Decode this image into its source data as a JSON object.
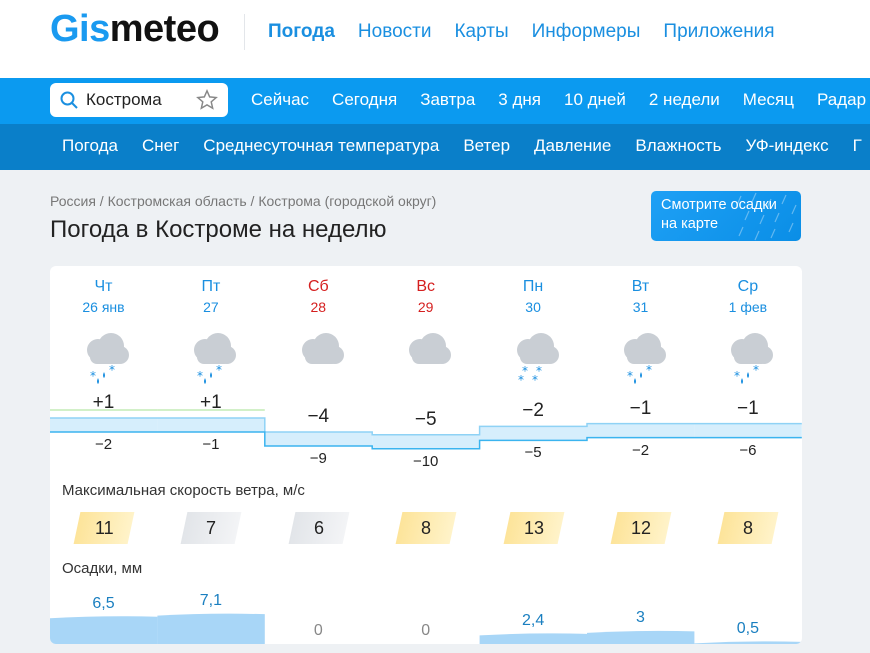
{
  "header": {
    "logo_part1": "Gis",
    "logo_part2": "meteo",
    "nav": [
      "Погода",
      "Новости",
      "Карты",
      "Информеры",
      "Приложения"
    ]
  },
  "search": {
    "city": "Кострома"
  },
  "period_nav": [
    "Сейчас",
    "Сегодня",
    "Завтра",
    "3 дня",
    "10 дней",
    "2 недели",
    "Месяц",
    "Радар"
  ],
  "param_nav": [
    "Погода",
    "Снег",
    "Среднесуточная температура",
    "Ветер",
    "Давление",
    "Влажность",
    "УФ-индекс",
    "Г"
  ],
  "breadcrumb": [
    "Россия",
    "Костромская область",
    "Кострома (городской округ)"
  ],
  "page_title": "Погода в Костроме на неделю",
  "map_button": "Смотрите осадки на карте",
  "days": [
    {
      "name": "Чт",
      "date": "26 янв",
      "weekend": false,
      "icon": "cloud-snow-rain-icon",
      "max": "+1",
      "min": "−2",
      "wind": "11",
      "precip": "6,5"
    },
    {
      "name": "Пт",
      "date": "27",
      "weekend": false,
      "icon": "cloud-snow-rain-icon",
      "max": "+1",
      "min": "−1",
      "wind": "7",
      "precip": "7,1"
    },
    {
      "name": "Сб",
      "date": "28",
      "weekend": true,
      "icon": "cloud-icon",
      "max": "−4",
      "min": "−9",
      "wind": "6",
      "precip": "0"
    },
    {
      "name": "Вс",
      "date": "29",
      "weekend": true,
      "icon": "cloud-icon",
      "max": "−5",
      "min": "−10",
      "wind": "8",
      "precip": "0"
    },
    {
      "name": "Пн",
      "date": "30",
      "weekend": false,
      "icon": "cloud-snow-icon",
      "max": "−2",
      "min": "−5",
      "wind": "13",
      "precip": "2,4"
    },
    {
      "name": "Вт",
      "date": "31",
      "weekend": false,
      "icon": "cloud-snow-rain-icon",
      "max": "−1",
      "min": "−2",
      "wind": "12",
      "precip": "3"
    },
    {
      "name": "Ср",
      "date": "1 фев",
      "weekend": false,
      "icon": "cloud-snow-rain-icon",
      "max": "−1",
      "min": "−6",
      "wind": "8",
      "precip": "0,5"
    }
  ],
  "wind_label": "Максимальная скорость ветра, м/с",
  "precip_label": "Осадки, мм",
  "colors": {
    "brand_blue": "#0b9af0",
    "nav_dark_blue": "#0a7fc9",
    "link_blue": "#1a8fe0",
    "weekend_red": "#d51f1f",
    "wind_yellow": "#fde49a",
    "wind_grey": "#e6e8eb",
    "precip_blue": "#a8d6f7"
  }
}
